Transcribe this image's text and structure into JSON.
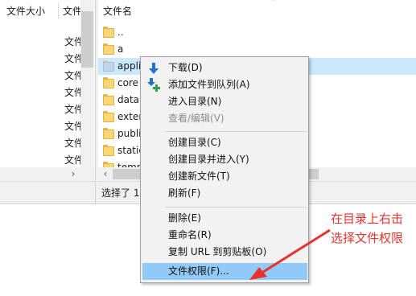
{
  "left_pane": {
    "columns": {
      "size": "文件大小",
      "type": "文件"
    },
    "rows": [
      "文件",
      "文件",
      "文件",
      "文件",
      "文件",
      "文件",
      "文件",
      "文件"
    ],
    "scroll_right_glyph": "›"
  },
  "right_pane": {
    "header": {
      "name": "文件名"
    },
    "rows": [
      {
        "name": "..",
        "selected": false
      },
      {
        "name": "a",
        "selected": false
      },
      {
        "name": "appli",
        "selected": true
      },
      {
        "name": "core",
        "selected": false
      },
      {
        "name": "data",
        "selected": false
      },
      {
        "name": "exter",
        "selected": false
      },
      {
        "name": "publi",
        "selected": false
      },
      {
        "name": "static",
        "selected": false
      },
      {
        "name": "temp",
        "selected": false
      }
    ],
    "scroll_left_glyph": "‹",
    "status": "选择了 1"
  },
  "context_menu": {
    "items": [
      {
        "label": "下载(D)",
        "icon": "download-arrow-icon",
        "disabled": false
      },
      {
        "label": "添加文件到队列(A)",
        "icon": "add-to-queue-icon",
        "disabled": false
      },
      {
        "label": "进入目录(N)",
        "disabled": false
      },
      {
        "label": "查看/编辑(V)",
        "disabled": true
      },
      {
        "label": "创建目录(C)",
        "disabled": false
      },
      {
        "label": "创建目录并进入(Y)",
        "disabled": false
      },
      {
        "label": "创建新文件(T)",
        "disabled": false
      },
      {
        "label": "刷新(F)",
        "disabled": false
      },
      {
        "label": "删除(E)",
        "disabled": false
      },
      {
        "label": "重命名(R)",
        "disabled": false
      },
      {
        "label": "复制 URL 到剪贴板(O)",
        "disabled": false
      },
      {
        "label": "文件权限(F)...",
        "disabled": false,
        "highlighted": true
      }
    ],
    "highlight_color": "#91c9f7"
  },
  "annotation": {
    "line1": "在目录上右击",
    "line2": "选择文件权限",
    "color": "#e8322e"
  },
  "colors": {
    "selection": "#cce8ff",
    "folder": "#f8d775",
    "download_arrow": "#1e72d2",
    "add_plus": "#2aa24a"
  }
}
